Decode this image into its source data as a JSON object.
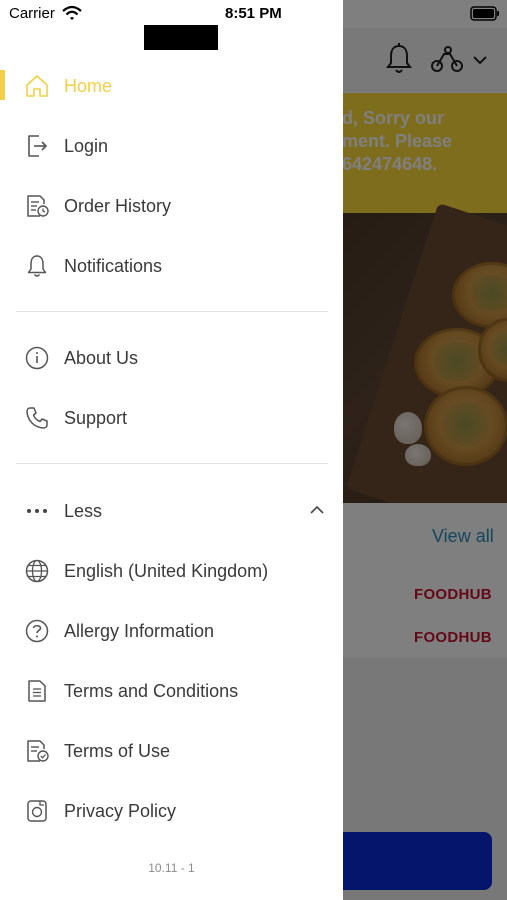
{
  "status_bar": {
    "carrier": "Carrier",
    "time": "8:51 PM"
  },
  "drawer": {
    "primary_items": [
      {
        "label": "Home",
        "icon": "home-icon",
        "active": true
      },
      {
        "label": "Login",
        "icon": "login-icon"
      },
      {
        "label": "Order History",
        "icon": "order-history-icon"
      },
      {
        "label": "Notifications",
        "icon": "bell-icon"
      }
    ],
    "secondary_items": [
      {
        "label": "About Us",
        "icon": "info-icon"
      },
      {
        "label": "Support",
        "icon": "phone-icon"
      }
    ],
    "more_toggle": {
      "label": "Less",
      "icon": "ellipsis-icon"
    },
    "more_items": [
      {
        "label": "English (United Kingdom)",
        "icon": "globe-icon"
      },
      {
        "label": "Allergy Information",
        "icon": "question-icon"
      },
      {
        "label": "Terms and Conditions",
        "icon": "document-icon"
      },
      {
        "label": "Terms of Use",
        "icon": "document-check-icon"
      },
      {
        "label": "Privacy Policy",
        "icon": "privacy-icon"
      }
    ],
    "version": "10.11 - 1"
  },
  "background": {
    "banner_lines": [
      "d, Sorry our",
      "ment. Please",
      "642474648."
    ],
    "view_all": "View all",
    "brand_logos": [
      "FOODHUB",
      "FOODHUB"
    ]
  },
  "colors": {
    "accent": "#f2cf47",
    "banner": "#ffdb3c",
    "primary_button": "#0a2bd6",
    "brand_red": "#c8102e",
    "link": "#2a8fb8"
  }
}
